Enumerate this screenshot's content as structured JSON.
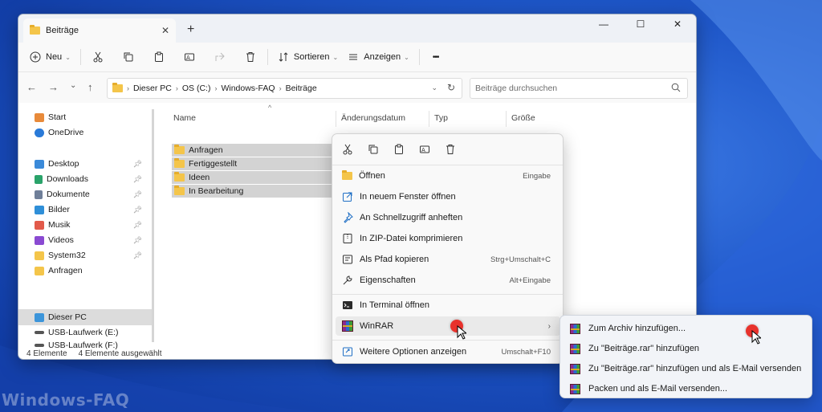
{
  "watermark": "Windows-FAQ",
  "window": {
    "tab_title": "Beiträge",
    "tab_close": "✕",
    "new_tab": "+",
    "controls": {
      "minimize": "—",
      "maximize": "☐",
      "close": "✕"
    }
  },
  "toolbar": {
    "new_label": "Neu",
    "sort_label": "Sortieren",
    "view_label": "Anzeigen",
    "more": "•••"
  },
  "address": {
    "crumbs": [
      "Dieser PC",
      "OS (C:)",
      "Windows-FAQ",
      "Beiträge"
    ],
    "search_placeholder": "Beiträge durchsuchen"
  },
  "sidebar": {
    "items": [
      {
        "label": "Start",
        "pinned": false
      },
      {
        "label": "OneDrive",
        "pinned": false
      },
      {
        "label": "Desktop",
        "pinned": true
      },
      {
        "label": "Downloads",
        "pinned": true
      },
      {
        "label": "Dokumente",
        "pinned": true
      },
      {
        "label": "Bilder",
        "pinned": true
      },
      {
        "label": "Musik",
        "pinned": true
      },
      {
        "label": "Videos",
        "pinned": true
      },
      {
        "label": "System32",
        "pinned": true
      },
      {
        "label": "Anfragen",
        "pinned": false
      },
      {
        "label": "Dieser PC",
        "pinned": false
      },
      {
        "label": "USB-Laufwerk (E:)",
        "pinned": false
      },
      {
        "label": "USB-Laufwerk (F:)",
        "pinned": false
      }
    ]
  },
  "columns": {
    "name": "Name",
    "date": "Änderungsdatum",
    "type": "Typ",
    "size": "Größe"
  },
  "files": [
    "Anfragen",
    "Fertiggestellt",
    "Ideen",
    "In Bearbeitung"
  ],
  "status": {
    "count": "4 Elemente",
    "selected": "4 Elemente ausgewählt"
  },
  "context_menu": {
    "items": [
      {
        "label": "Öffnen",
        "shortcut": "Eingabe"
      },
      {
        "label": "In neuem Fenster öffnen",
        "shortcut": ""
      },
      {
        "label": "An Schnellzugriff anheften",
        "shortcut": ""
      },
      {
        "label": "In ZIP-Datei komprimieren",
        "shortcut": ""
      },
      {
        "label": "Als Pfad kopieren",
        "shortcut": "Strg+Umschalt+C"
      },
      {
        "label": "Eigenschaften",
        "shortcut": "Alt+Eingabe"
      },
      {
        "label": "In Terminal öffnen",
        "shortcut": ""
      },
      {
        "label": "WinRAR",
        "shortcut": ""
      },
      {
        "label": "Weitere Optionen anzeigen",
        "shortcut": "Umschalt+F10"
      }
    ],
    "chevron": "›"
  },
  "winrar_submenu": {
    "items": [
      "Zum Archiv hinzufügen...",
      "Zu \"Beiträge.rar\" hinzufügen",
      "Zu \"Beiträge.rar\" hinzufügen und als E-Mail versenden",
      "Packen und als E-Mail versenden..."
    ]
  },
  "colors": {
    "accent": "#0067c0",
    "folder": "#f4c54a",
    "selection": "#d3d3d3",
    "click_marker": "#e8322c"
  }
}
